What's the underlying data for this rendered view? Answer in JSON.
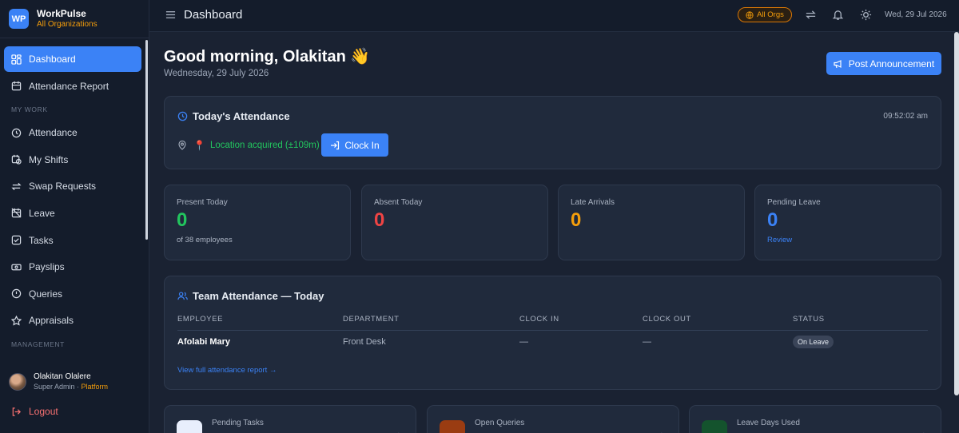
{
  "app": {
    "logo": "WP",
    "name": "WorkPulse",
    "org": "All Organizations"
  },
  "sidebar": {
    "items_top": [
      {
        "label": "Dashboard",
        "icon": "grid-icon",
        "active": true
      },
      {
        "label": "Attendance Report",
        "icon": "calendar-icon"
      }
    ],
    "section_my_work": "MY WORK",
    "items_work": [
      {
        "label": "Attendance",
        "icon": "clock-icon"
      },
      {
        "label": "My Shifts",
        "icon": "calendar-clock-icon"
      },
      {
        "label": "Swap Requests",
        "icon": "swap-icon"
      },
      {
        "label": "Leave",
        "icon": "calendar-off-icon"
      },
      {
        "label": "Tasks",
        "icon": "checkbox-icon"
      },
      {
        "label": "Payslips",
        "icon": "money-icon"
      },
      {
        "label": "Queries",
        "icon": "alert-circle-icon"
      },
      {
        "label": "Appraisals",
        "icon": "star-icon"
      }
    ],
    "section_management": "MANAGEMENT",
    "user": {
      "name": "Olakitan Olalere",
      "role": "Super Admin · ",
      "scope": "Platform"
    },
    "logout": "Logout"
  },
  "topbar": {
    "title": "Dashboard",
    "org_filter": "All Orgs",
    "date": "Wed, 29 Jul 2026"
  },
  "greeting": {
    "text": "Good morning, Olakitan",
    "emoji": "👋",
    "date": "Wednesday, 29 July 2026"
  },
  "post_button": "Post Announcement",
  "attendance": {
    "title": "Today's Attendance",
    "time": "09:52:02 am",
    "location": "Location acquired (±109m)",
    "clock_in": "Clock In"
  },
  "stats": [
    {
      "label": "Present Today",
      "value": "0",
      "sub": "of 38 employees",
      "color": "#22c55e"
    },
    {
      "label": "Absent Today",
      "value": "0",
      "sub": "",
      "color": "#ef4444"
    },
    {
      "label": "Late Arrivals",
      "value": "0",
      "sub": "",
      "color": "#f59e0b"
    },
    {
      "label": "Pending Leave",
      "value": "0",
      "sub": "Review",
      "color": "#3b82f6"
    }
  ],
  "team": {
    "title": "Team Attendance — Today",
    "columns": [
      "EMPLOYEE",
      "DEPARTMENT",
      "CLOCK IN",
      "CLOCK OUT",
      "STATUS"
    ],
    "rows": [
      {
        "employee": "Afolabi Mary",
        "department": "Front Desk",
        "clock_in": "—",
        "clock_out": "—",
        "status": "On Leave"
      }
    ],
    "view_link": "View full attendance report →"
  },
  "bottom_cards": [
    {
      "label": "Pending Tasks",
      "color": "#3b82f6"
    },
    {
      "label": "Open Queries",
      "color": "#f97316"
    },
    {
      "label": "Leave Days Used",
      "color": "#22c55e"
    }
  ]
}
